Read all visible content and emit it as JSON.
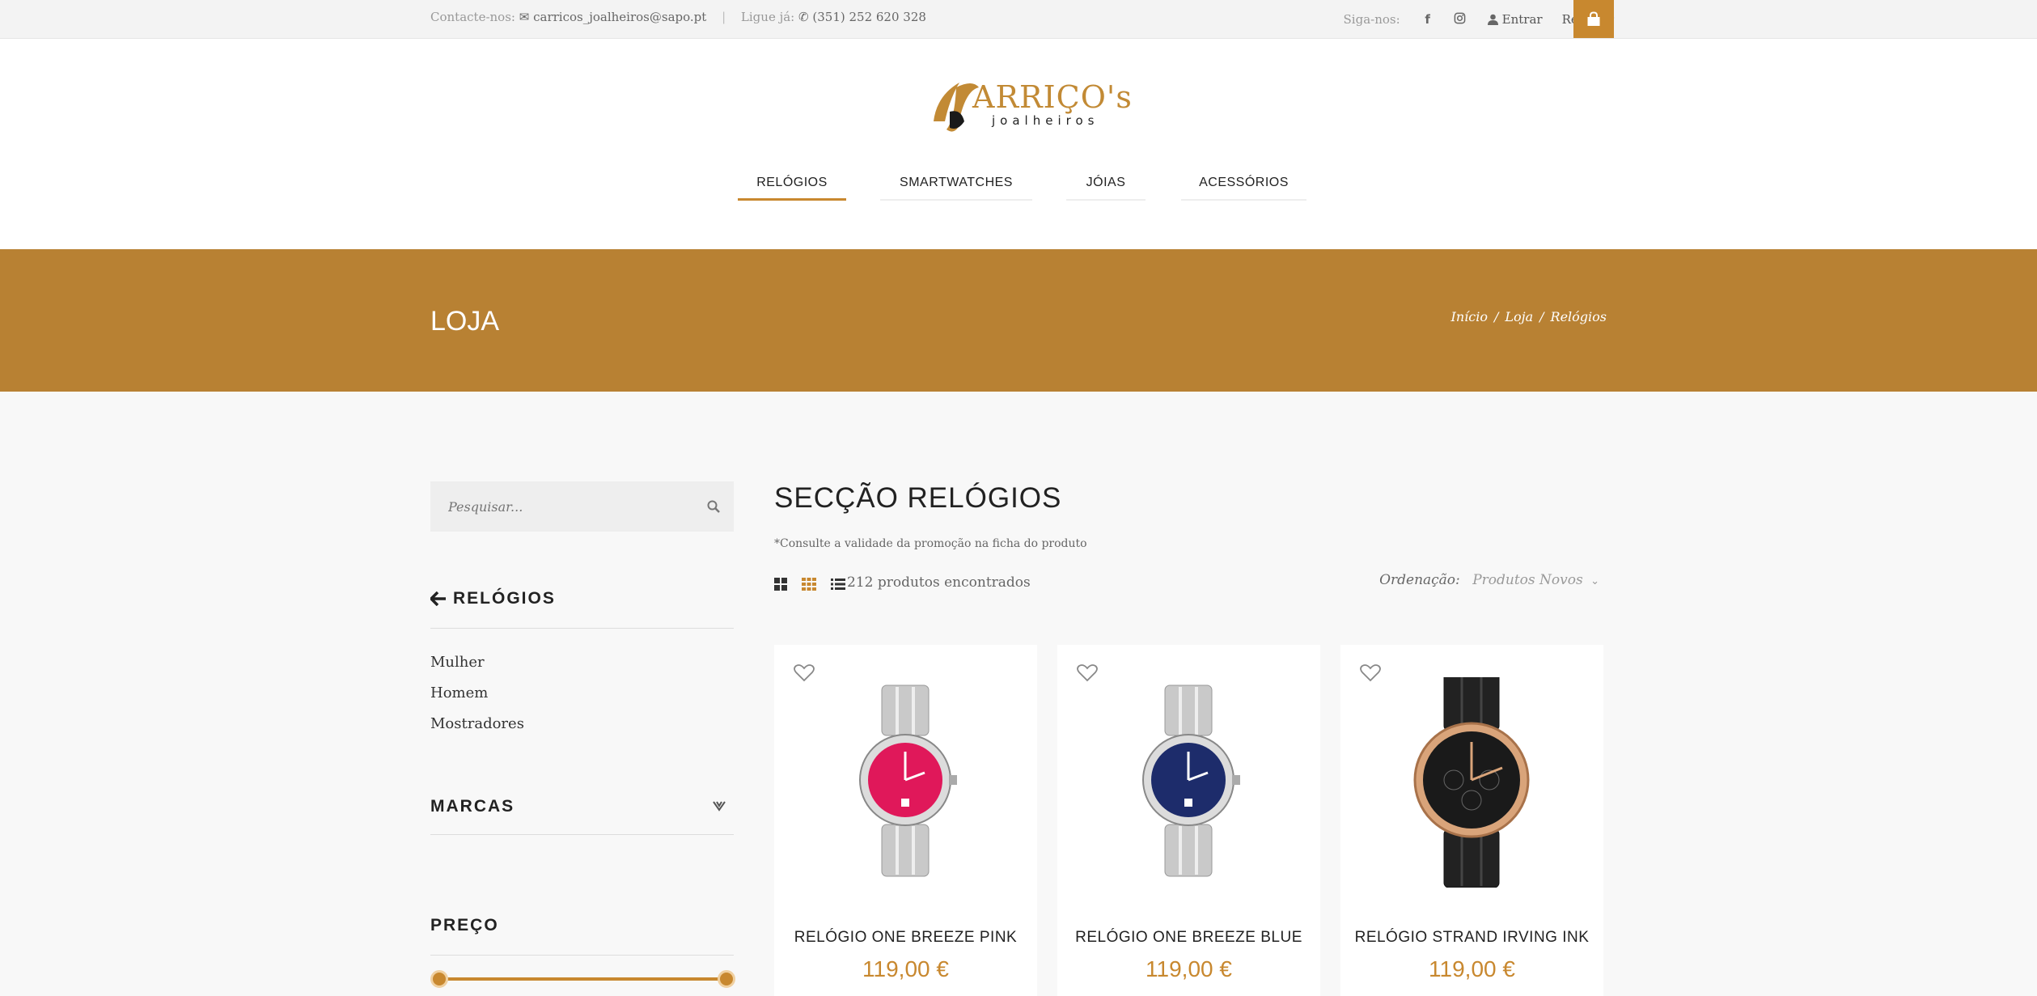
{
  "topbar": {
    "contact_label": "Contacte-nos:",
    "email": "carricos_joalheiros@sapo.pt",
    "phone_label": "Ligue já:",
    "phone": "(351) 252 620 328",
    "follow_label": "Siga-nos:",
    "facebook_icon": "f",
    "login": "Entrar",
    "register": "Registar"
  },
  "logo": {
    "brand": "ARRIÇO's",
    "sub": "joalheiros"
  },
  "nav": [
    "RELÓGIOS",
    "SMARTWATCHES",
    "JÓIAS",
    "ACESSÓRIOS"
  ],
  "banner": {
    "title": "LOJA",
    "crumbs": [
      "Início",
      "Loja",
      "Relógios"
    ]
  },
  "sidebar": {
    "search_placeholder": "Pesquisar...",
    "category_title": "RELÓGIOS",
    "links": [
      "Mulher",
      "Homem",
      "Mostradores"
    ],
    "brands_title": "MARCAS",
    "price_title": "PREÇO"
  },
  "main": {
    "title": "SECÇÃO RELÓGIOS",
    "note": "*Consulte a validade da promoção na ficha do produto",
    "found": "212 produtos encontrados",
    "sort_label": "Ordenação:",
    "sort_value": "Produtos Novos"
  },
  "products": [
    {
      "name": "RELÓGIO ONE BREEZE PINK",
      "price": "119,00 €",
      "dial_color": "#e0185a"
    },
    {
      "name": "RELÓGIO ONE BREEZE BLUE",
      "price": "119,00 €",
      "dial_color": "#1d2c6b"
    },
    {
      "name": "RELÓGIO STRAND IRVING INK",
      "price": "119,00 €",
      "dial_color": "#1a1a1a"
    }
  ],
  "colors": {
    "accent": "#c8882f",
    "banner": "#b88133"
  }
}
